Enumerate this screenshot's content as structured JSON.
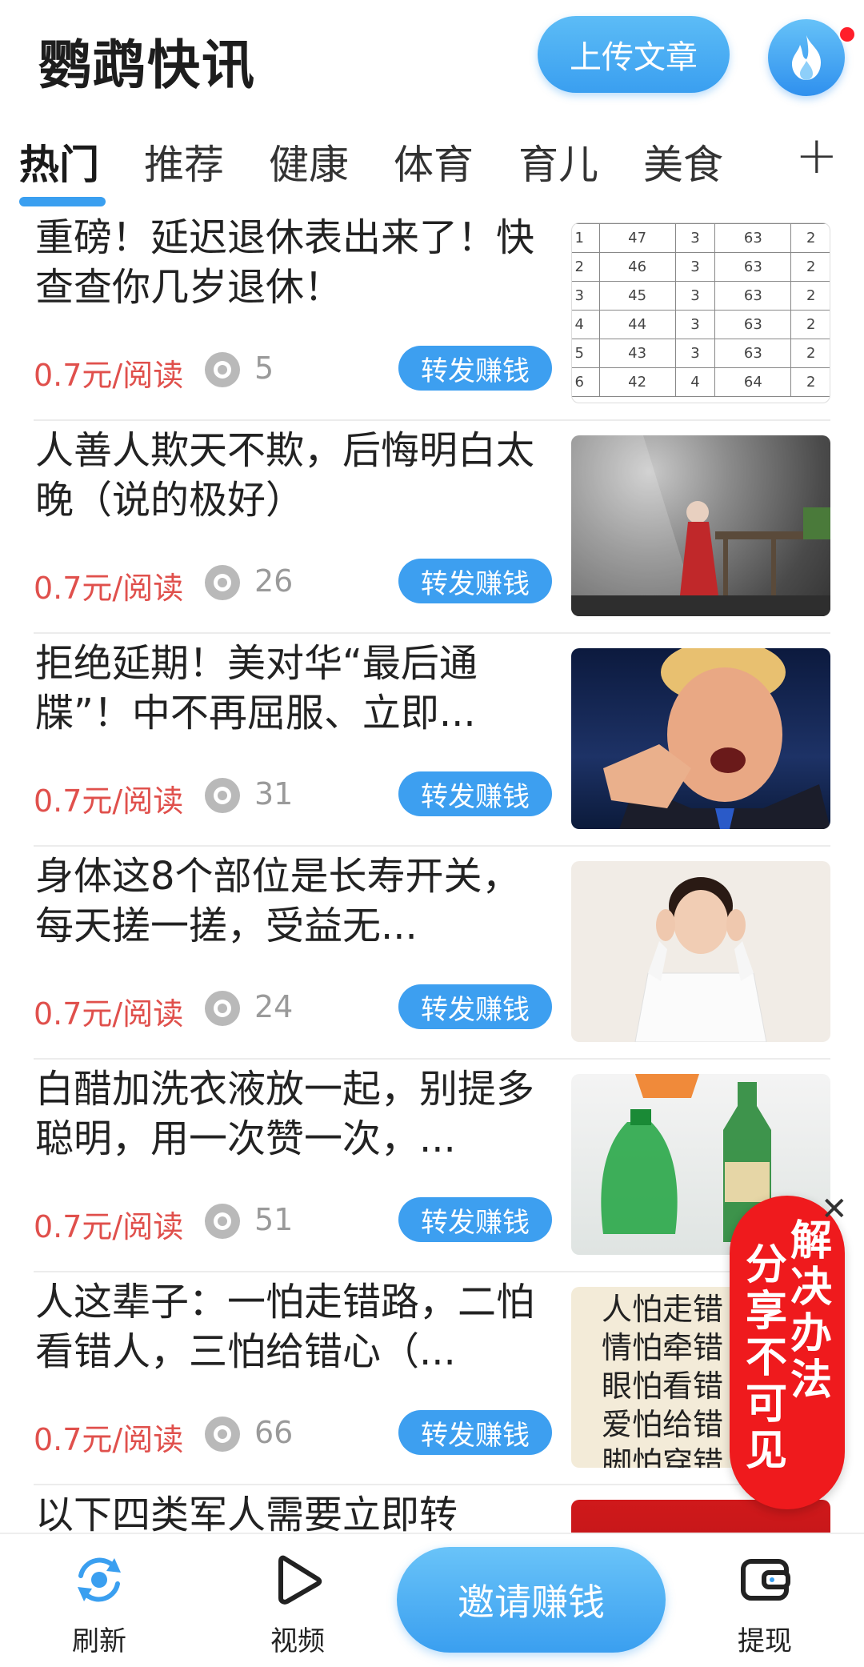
{
  "header": {
    "app_title": "鹦鹉快讯",
    "upload_label": "上传文章"
  },
  "tabs": [
    {
      "label": "热门",
      "active": true
    },
    {
      "label": "推荐"
    },
    {
      "label": "健康"
    },
    {
      "label": "体育"
    },
    {
      "label": "育儿"
    },
    {
      "label": "美食"
    }
  ],
  "tab_add": "+",
  "articles": [
    {
      "title": "重磅！延迟退休表出来了！快查查你几岁退休！",
      "price": "0.7元/阅读",
      "views": "5",
      "share": "转发赚钱",
      "thumb": "retirement-table"
    },
    {
      "title": "人善人欺天不欺，后悔明白太晚（说的极好）",
      "price": "0.7元/阅读",
      "views": "26",
      "share": "转发赚钱",
      "thumb": "statue-photo"
    },
    {
      "title": "拒绝延期！美对华“最后通牒”！中不再屈服、立即...",
      "price": "0.7元/阅读",
      "views": "31",
      "share": "转发赚钱",
      "thumb": "pointing-man-photo"
    },
    {
      "title": "身体这8个部位是长寿开关，每天搓一搓，受益无...",
      "price": "0.7元/阅读",
      "views": "24",
      "share": "转发赚钱",
      "thumb": "woman-ears-photo"
    },
    {
      "title": "白醋加洗衣液放一起，别提多聪明，用一次赞一次，...",
      "price": "0.7元/阅读",
      "views": "51",
      "share": "转发赚钱",
      "thumb": "bottles-photo"
    },
    {
      "title": "人这辈子：一怕走错路，二怕看错人，三怕给错心（...",
      "price": "0.7元/阅读",
      "views": "66",
      "share": "转发赚钱",
      "thumb": "text-image"
    },
    {
      "title": "以下四类军人需要立即转",
      "thumb": "red-banner"
    }
  ],
  "retirement_table": [
    [
      "1",
      "47",
      "3",
      "63",
      "2"
    ],
    [
      "2",
      "46",
      "3",
      "63",
      "2"
    ],
    [
      "3",
      "45",
      "3",
      "63",
      "2"
    ],
    [
      "4",
      "44",
      "3",
      "63",
      "2"
    ],
    [
      "5",
      "43",
      "3",
      "63",
      "2"
    ],
    [
      "6",
      "42",
      "4",
      "64",
      "2"
    ]
  ],
  "text_image_lines": [
    "人怕走错",
    "情怕牵错",
    "眼怕看错",
    "爱怕给错",
    "脚怕穿错"
  ],
  "promo": {
    "col_right": "解决办法",
    "col_left": "分享不可见",
    "close": "✕"
  },
  "bottom_nav": {
    "refresh": "刷新",
    "video": "视频",
    "invite": "邀请赚钱",
    "withdraw": "提现"
  },
  "colors": {
    "accent": "#3a9ff0",
    "price": "#e0504c",
    "promo": "#ef1a1d"
  }
}
